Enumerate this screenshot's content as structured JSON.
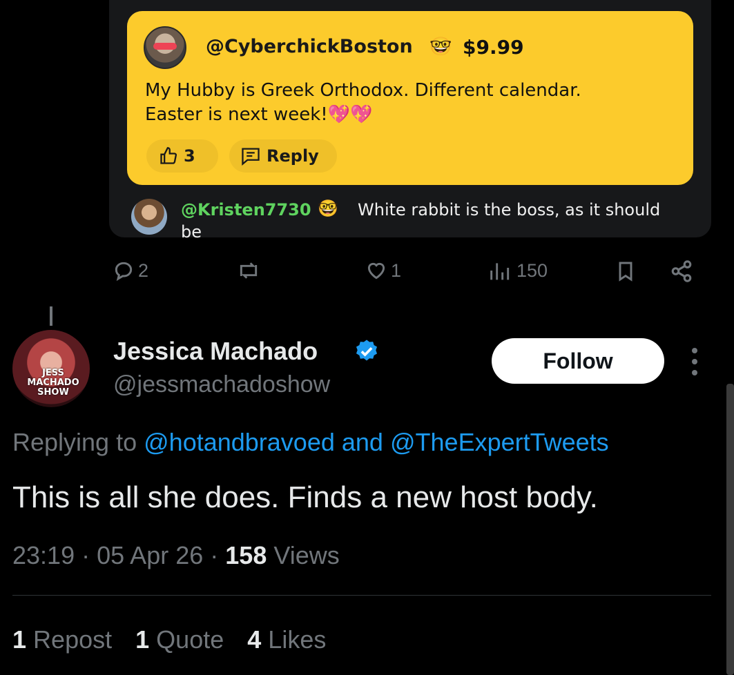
{
  "embedded": {
    "superchat": {
      "username": "@CyberchickBoston",
      "badge_emoji": "🤓",
      "amount": "$9.99",
      "message_line1": "My Hubby is Greek Orthodox. Different calendar.",
      "message_line2": "Easter is next week!",
      "hearts": "💖💖",
      "like_count": "3",
      "reply_label": "Reply",
      "bg_color": "#fccb2c"
    },
    "sub_comment": {
      "username": "@Kristen7730",
      "badge_emoji": "🤓",
      "text_line1": "White rabbit is the boss, as it should",
      "text_line2": "be",
      "username_color": "#5fd35f"
    }
  },
  "embedded_actions": {
    "replies": "2",
    "likes": "1",
    "views": "150"
  },
  "tweet": {
    "avatar_text": "JESS MACHADO SHOW",
    "display_name": "Jessica Machado",
    "handle": "@jessmachadoshow",
    "follow_label": "Follow",
    "replying_prefix": "Replying to",
    "replying_user1": "@hotandbravoed",
    "replying_and": "and",
    "replying_user2": "@TheExpertTweets",
    "text": "This is all she does.  Finds a new host body.",
    "time": "23:19",
    "date": "05 Apr 26",
    "views_count": "158",
    "views_label": "Views",
    "sep": "·"
  },
  "stats": {
    "reposts_count": "1",
    "reposts_label": "Repost",
    "quotes_count": "1",
    "quotes_label": "Quote",
    "likes_count": "4",
    "likes_label": "Likes"
  },
  "colors": {
    "link": "#1d9bf0",
    "muted": "#71767b",
    "verified": "#1d9bf0"
  }
}
